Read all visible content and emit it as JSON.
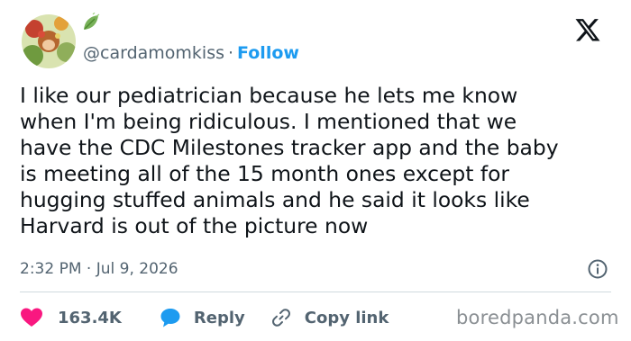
{
  "tweet": {
    "handle": "@cardamomkiss",
    "separator": "·",
    "follow_label": "Follow",
    "text_lines": [
      "I like our pediatrician because he lets me know",
      "when I'm being ridiculous. I mentioned that we",
      "have the CDC Milestones tracker app and the baby",
      "is meeting all of the 15 month ones except for",
      "hugging stuffed animals and he said it looks like",
      "Harvard is out of the picture now"
    ],
    "timestamp": "2:32 PM · Jul 9, 2026"
  },
  "actions": {
    "like_count": "163.4K",
    "reply_label": "Reply",
    "copy_link_label": "Copy link"
  },
  "watermark": "boredpanda.com",
  "icons": {
    "avatar": "avatar-illustration",
    "badge": "leaf-emoji-icon",
    "platform": "x-logo-icon",
    "info": "info-icon",
    "like": "heart-icon",
    "reply": "speech-bubble-icon",
    "copy": "link-icon"
  },
  "colors": {
    "text": "#0f1419",
    "secondary": "#536471",
    "follow": "#1d9bf0",
    "heart": "#f91880",
    "reply_bubble": "#1d9bf0",
    "divider": "#cfd9de",
    "watermark": "#8a8f93"
  }
}
